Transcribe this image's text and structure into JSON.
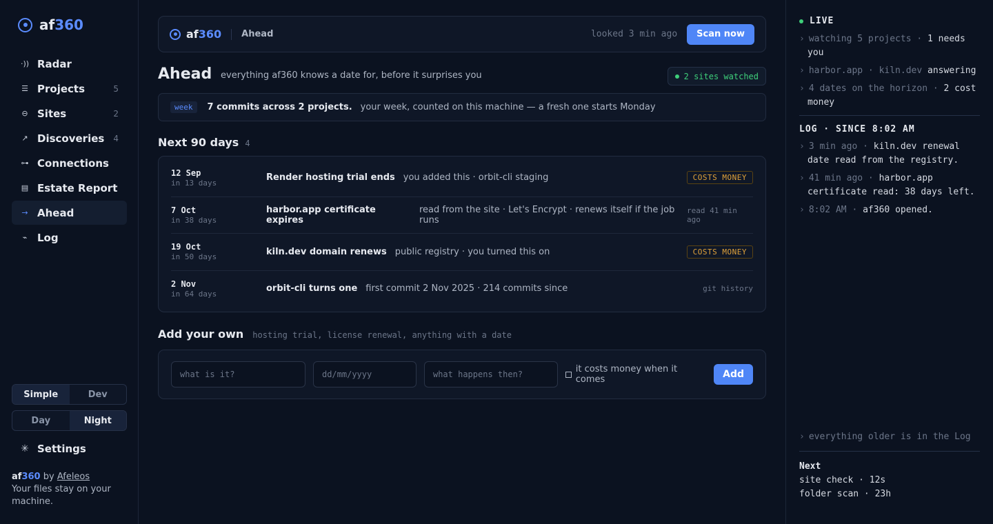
{
  "brand": {
    "prefix": "af",
    "suffix": "360"
  },
  "sidebar": {
    "items": [
      {
        "icon": "radar-icon",
        "glyph": "·))",
        "label": "Radar",
        "count": ""
      },
      {
        "icon": "projects-icon",
        "glyph": "☰",
        "label": "Projects",
        "count": "5"
      },
      {
        "icon": "sites-icon",
        "glyph": "⊖",
        "label": "Sites",
        "count": "2"
      },
      {
        "icon": "discoveries-icon",
        "glyph": "↗",
        "label": "Discoveries",
        "count": "4"
      },
      {
        "icon": "connections-icon",
        "glyph": "⊶",
        "label": "Connections",
        "count": ""
      },
      {
        "icon": "estate-report-icon",
        "glyph": "▤",
        "label": "Estate Report",
        "count": ""
      },
      {
        "icon": "ahead-icon",
        "glyph": "→",
        "label": "Ahead",
        "count": "",
        "active": true
      },
      {
        "icon": "log-icon",
        "glyph": "⌁",
        "label": "Log",
        "count": ""
      }
    ],
    "mode": {
      "simple": "Simple",
      "dev": "Dev",
      "selected": "Simple"
    },
    "theme": {
      "day": "Day",
      "night": "Night",
      "selected": "Night"
    },
    "settings_label": "Settings",
    "credit": {
      "by": "by",
      "author": "Afeleos",
      "tagline": "Your files stay on your machine."
    }
  },
  "topbar": {
    "page": "Ahead",
    "looked": "looked 3 min ago",
    "scan_label": "Scan now"
  },
  "header": {
    "title": "Ahead",
    "subtitle": "everything af360 knows a date for, before it surprises you",
    "pill": "2 sites watched"
  },
  "week": {
    "tag": "week",
    "summary": "7 commits across 2 projects.",
    "note": "your week, counted on this machine — a fresh one starts Monday"
  },
  "upcoming": {
    "title": "Next 90 days",
    "count": "4",
    "rows": [
      {
        "date": "12 Sep",
        "in": "in 13 days",
        "title": "Render hosting trial ends",
        "desc": "you added this · orbit-cli staging",
        "badge": "COSTS MONEY",
        "meta": ""
      },
      {
        "date": "7 Oct",
        "in": "in 38 days",
        "title": "harbor.app certificate expires",
        "desc": "read from the site · Let's Encrypt · renews itself if the job runs",
        "badge": "",
        "meta": "read 41 min ago"
      },
      {
        "date": "19 Oct",
        "in": "in 50 days",
        "title": "kiln.dev domain renews",
        "desc": "public registry · you turned this on",
        "badge": "COSTS MONEY",
        "meta": ""
      },
      {
        "date": "2 Nov",
        "in": "in 64 days",
        "title": "orbit-cli turns one",
        "desc": "first commit 2 Nov 2025 · 214 commits since",
        "badge": "",
        "meta": "git history"
      }
    ]
  },
  "add_form": {
    "title": "Add your own",
    "subtitle": "hosting trial, license renewal, anything with a date",
    "what_placeholder": "what is it?",
    "date_placeholder": "dd/mm/yyyy",
    "then_placeholder": "what happens then?",
    "costs_label": "it costs money when it comes",
    "add_label": "Add"
  },
  "panel": {
    "live": "LIVE",
    "feed": [
      {
        "dim": "watching 5 projects · ",
        "text": "1 needs you"
      },
      {
        "dim": "harbor.app · kiln.dev ",
        "text": "answering"
      },
      {
        "dim": "4 dates on the horizon · ",
        "text": "2 cost money"
      }
    ],
    "log_title": "LOG · SINCE 8:02 AM",
    "log": [
      {
        "dim": "3 min ago · ",
        "text": "kiln.dev renewal date read from the registry."
      },
      {
        "dim": "41 min ago · ",
        "text": "harbor.app certificate read: 38 days left."
      },
      {
        "dim": "8:02 AM · ",
        "text": "af360 opened."
      }
    ],
    "older": "everything older is in the Log",
    "next_title": "Next",
    "next": [
      "site check · 12s",
      "folder scan · 23h"
    ]
  },
  "colors": {
    "accent": "#5b8cff",
    "live": "#3ecf7a",
    "costs": "#e0a23a",
    "bg": "#0b1220"
  }
}
